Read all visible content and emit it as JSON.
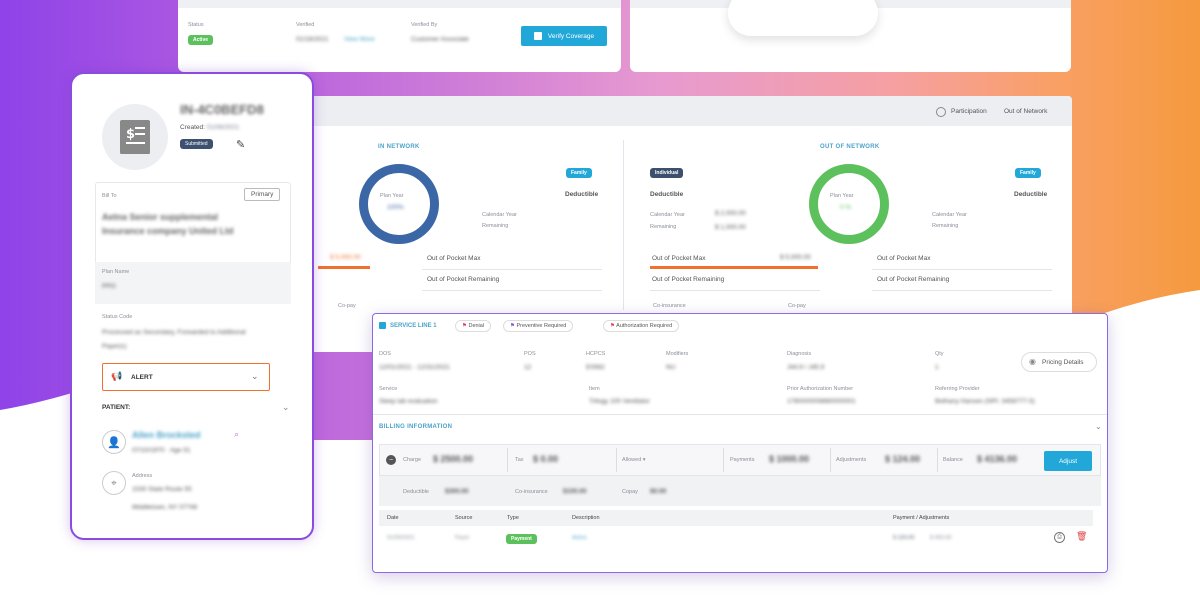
{
  "top_left_card": {
    "col1_label": "Status",
    "col1_badge": "Active",
    "col2_label": "Verified",
    "col2_value": "01/18/2021",
    "col2_link": "View More",
    "col3_label": "Verified By",
    "col3_value": "Customer Associate",
    "verify_button": "Verify Coverage"
  },
  "participation": {
    "label": "Participation",
    "value": "Out of Network"
  },
  "in_network": {
    "heading": "IN NETWORK",
    "badge": "Family",
    "deductible_label": "Deductible",
    "ring_label": "Plan Year",
    "ring_value": "100%",
    "calendar_year": "Calendar Year",
    "remaining": "Remaining",
    "oop_max_value": "$ 5,000.00",
    "oop_max": "Out of Pocket Max",
    "oop_remaining": "Out of Pocket Remaining",
    "bottom_label": "Co-pay"
  },
  "out_network": {
    "heading": "OUT OF NETWORK",
    "badge_left": "Individual",
    "badge_right": "Family",
    "deductible_left": "Deductible",
    "deductible_right": "Deductible",
    "calendar_year": "Calendar Year",
    "calendar_value": "$ 2,000.00",
    "remaining": "Remaining",
    "remaining_value": "$ 1,000.00",
    "ring_label": "Plan Year",
    "ring_value": "0 %",
    "calendar_year_r": "Calendar Year",
    "remaining_r": "Remaining",
    "oop_max": "Out of Pocket Max",
    "oop_max_value": "$ 5,000.00",
    "oop_remaining": "Out of Pocket Remaining",
    "oop_max_r": "Out of Pocket Max",
    "oop_remaining_r": "Out of Pocket Remaining",
    "bottom_label1": "Co-insurance",
    "bottom_label2": "Co-pay"
  },
  "patient_card": {
    "invoice_id": "IN-4C0BEFD8",
    "created_label": "Created",
    "created_value": "01/08/2021",
    "status_badge": "Submitted",
    "bill_to_label": "Bill To",
    "primary_button": "Primary",
    "bill_to_value": "Aetna Senior supplemental Insurance company United Ltd",
    "plan_name_label": "Plan Name",
    "plan_name_value": "PPO",
    "status_code_label": "Status Code",
    "status_code_value": "Processed as Secondary, Forwarded to Additional Payer(s)",
    "alert_label": "ALERT",
    "patient_heading": "PATIENT:",
    "patient_name": "Allen Brocksted",
    "patient_meta": "07/10/1970 · Age 51",
    "address_label": "Address",
    "address_line1": "1530 State Route 55",
    "address_line2": "Middletown, NY 07748"
  },
  "service_line": {
    "title": "SERVICE LINE 1",
    "chips": [
      "Denial",
      "Preventive Required",
      "Authorization Required"
    ],
    "dos_label": "DOS",
    "dos_value": "12/01/2021 - 12/31/2021",
    "pos_label": "POS",
    "pos_value": "12",
    "hcpcs_label": "HCPCS",
    "hcpcs_value": "E0562",
    "mod_label": "Modifiers",
    "mod_value": "NU",
    "dx_label": "Diagnosis",
    "dx_value": "J44.9 / J45.9",
    "qty_label": "Qty",
    "qty_value": "1",
    "pricing_details": "Pricing Details",
    "service_label": "Service",
    "service_value": "Sleep lab evaluation",
    "item_label": "Item",
    "item_value": "Trilogy 100 Ventilator",
    "prior_auth_label": "Prior Authorization Number",
    "prior_auth_value": "1780000008880000001",
    "referring_label": "Referring Provider",
    "referring_value": "Bethany Hansen (NPI: 3458777-5)",
    "billing_heading": "BILLING INFORMATION",
    "charge_label": "Charge",
    "charge_value": "$ 2500.00",
    "tax_label": "Tax",
    "tax_value": "$ 0.00",
    "allowed_label": "Allowed",
    "payments_label": "Payments",
    "payments_value": "$ 1000.00",
    "adjustments_label": "Adjustments",
    "adjustments_value": "$ 124.00",
    "balance_label": "Balance",
    "balance_value": "$ 4136.00",
    "adjust_button": "Adjust",
    "deductible_label": "Deductible",
    "deductible_value": "$300.00",
    "coinsurance_label": "Co-insurance",
    "coinsurance_value": "$100.00",
    "copay_label": "Copay",
    "copay_value": "$0.00",
    "table_headers": [
      "Date",
      "Source",
      "Type",
      "Description",
      "Payment / Adjustments"
    ],
    "row": {
      "date": "01/09/2021",
      "source": "Payer",
      "type": "Payment",
      "description": "Aetna",
      "amount": "$ 120.00",
      "amount2": "$ 400.00"
    }
  },
  "colors": {
    "accent": "#22a8d8",
    "ring_in": "#3c67a6",
    "ring_out": "#5cc15c",
    "orange": "#f0702e",
    "border": "#8a4ce0"
  }
}
